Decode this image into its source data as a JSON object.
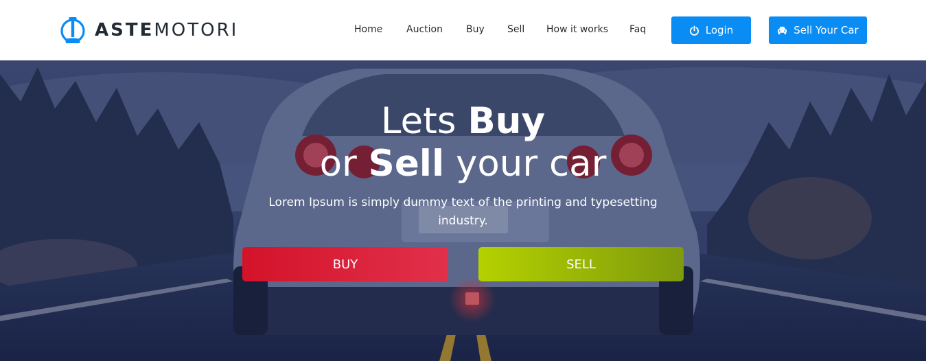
{
  "brand": {
    "name_bold": "ASTE",
    "name_light": "MOTORI",
    "accent_color": "#0a8cf5"
  },
  "nav": {
    "items": [
      {
        "label": "Home"
      },
      {
        "label": "Auction"
      },
      {
        "label": "Buy"
      },
      {
        "label": "Sell"
      },
      {
        "label": "How it works"
      },
      {
        "label": "Faq"
      }
    ],
    "login_label": "Login",
    "login_icon": "power-icon",
    "sell_car_label": "Sell Your Car",
    "sell_car_icon": "car-icon"
  },
  "hero": {
    "line1_light": "Lets",
    "line1_bold": "Buy",
    "line2_light_a": "or",
    "line2_bold": "Sell",
    "line2_light_b": "your car",
    "subtitle": "Lorem Ipsum is simply dummy text of the printing and typesetting industry.",
    "buy_label": "BUY",
    "sell_label": "SELL",
    "buy_color": "#d3132a",
    "sell_color": "#9cb806"
  }
}
